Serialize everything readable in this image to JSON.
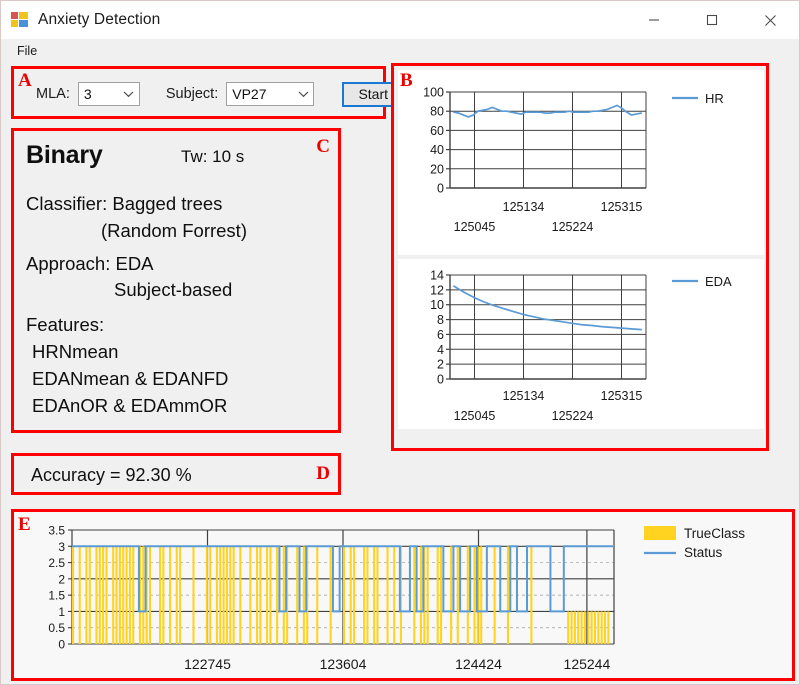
{
  "window": {
    "title": "Anxiety Detection",
    "icon": "app-icon",
    "minimize_label": "─",
    "maximize_label": "☐",
    "close_label": "✕"
  },
  "menu": {
    "items": [
      "File"
    ],
    "file_label": "File"
  },
  "annotations": {
    "a": "A",
    "b": "B",
    "c": "C",
    "d": "D",
    "e": "E",
    "color": "#ff0000"
  },
  "panelA": {
    "mla_label": "MLA:",
    "mla_value": "3",
    "subject_label": "Subject:",
    "subject_value": "VP27",
    "start_label": "Start"
  },
  "panelC": {
    "mode": "Binary",
    "tw": "Tw: 10 s",
    "classifier_line1": "Classifier: Bagged trees",
    "classifier_line2": "(Random Forrest)",
    "approach_line1": "Approach: EDA",
    "approach_line2": "Subject-based",
    "features_label": "Features:",
    "feature_1": "HRNmean",
    "feature_2": "EDANmean & EDANFD",
    "feature_3": "EDAnOR & EDAmmOR"
  },
  "panelD": {
    "accuracy_text": "Accuracy = 92.30 %"
  },
  "colors": {
    "series_blue": "#5b9bd5",
    "true_class_yellow": "#ffd320",
    "axis": "#404040",
    "accent_red": "#ff0000",
    "start_border_blue": "#1878d4"
  },
  "chart_data": [
    {
      "id": "hr-chart",
      "type": "line",
      "title": "",
      "xlabel": "",
      "ylabel": "",
      "ylim": [
        0,
        100
      ],
      "yticks": [
        0,
        20,
        40,
        60,
        80,
        100
      ],
      "xticks": [
        "125045",
        "125134",
        "125224",
        "125315"
      ],
      "xtick_positions": [
        0.125,
        0.375,
        0.625,
        0.875
      ],
      "grid": true,
      "legend": [
        {
          "name": "HR",
          "color": "#5b9bd5",
          "marker": "line"
        }
      ],
      "legend_position": "right",
      "series": [
        {
          "name": "HR",
          "color": "#5b9bd5",
          "x": [
            0,
            1,
            2,
            3,
            4,
            5,
            6,
            7,
            8,
            9,
            10,
            11,
            12,
            13,
            14,
            15,
            16,
            17,
            18,
            19,
            20,
            21,
            22,
            23,
            24,
            25,
            26,
            27,
            28,
            29,
            30,
            31,
            32,
            33,
            34,
            35,
            36,
            37,
            38,
            39
          ],
          "values": [
            79,
            78,
            76,
            74,
            76,
            80,
            81,
            82,
            84,
            82,
            80,
            80,
            79,
            78,
            77,
            79,
            79,
            79,
            79,
            78,
            78,
            79,
            79,
            79,
            80,
            79,
            79,
            79,
            79,
            80,
            80,
            81,
            82,
            84,
            86,
            83,
            79,
            76,
            77,
            78
          ]
        }
      ]
    },
    {
      "id": "eda-chart",
      "type": "line",
      "title": "",
      "xlabel": "",
      "ylabel": "",
      "ylim": [
        0,
        14
      ],
      "yticks": [
        0,
        2,
        4,
        6,
        8,
        10,
        12,
        14
      ],
      "xticks": [
        "125045",
        "125134",
        "125224",
        "125315"
      ],
      "xtick_positions": [
        0.125,
        0.375,
        0.625,
        0.875
      ],
      "grid": true,
      "legend": [
        {
          "name": "EDA",
          "color": "#5b9bd5",
          "marker": "line"
        }
      ],
      "legend_position": "right",
      "series": [
        {
          "name": "EDA",
          "color": "#5b9bd5",
          "x": [
            0,
            1,
            2,
            3,
            4,
            5,
            6,
            7,
            8,
            9,
            10,
            11,
            12,
            13,
            14,
            15,
            16,
            17,
            18,
            19
          ],
          "values": [
            12.5,
            11.7,
            11.0,
            10.4,
            9.9,
            9.5,
            9.1,
            8.7,
            8.4,
            8.1,
            7.9,
            7.7,
            7.5,
            7.3,
            7.2,
            7.05,
            6.95,
            6.85,
            6.75,
            6.65
          ]
        }
      ]
    },
    {
      "id": "classification-chart",
      "type": "bar",
      "title": "",
      "xlabel": "",
      "ylabel": "",
      "ylim": [
        0,
        3.5
      ],
      "yticks": [
        0,
        0.5,
        1,
        1.5,
        2,
        2.5,
        3,
        3.5
      ],
      "xticks": [
        "122745",
        "123604",
        "124424",
        "125244"
      ],
      "xtick_positions": [
        0.25,
        0.5,
        0.75,
        0.95
      ],
      "grid": true,
      "legend": [
        {
          "name": "TrueClass",
          "color": "#ffd320",
          "marker": "swatch"
        },
        {
          "name": "Status",
          "color": "#5b9bd5",
          "marker": "line"
        }
      ],
      "legend_position": "right",
      "series": [
        {
          "name": "TrueClass",
          "color": "#ffd320",
          "values": [
            3,
            0,
            3,
            0,
            3,
            3,
            0,
            3,
            3,
            3,
            3,
            0,
            3,
            3,
            3,
            3,
            3,
            3,
            3,
            0,
            3,
            3,
            3,
            3,
            0,
            0,
            3,
            3,
            0,
            3,
            0,
            3,
            3,
            0,
            0,
            0,
            3,
            0,
            0,
            0,
            3,
            3,
            0,
            3,
            3,
            3,
            3,
            3,
            3,
            0,
            3,
            0,
            0,
            3,
            0,
            3,
            3,
            0,
            3,
            3,
            0,
            3,
            0,
            3,
            3,
            0,
            0,
            3,
            0,
            3,
            3,
            0,
            0,
            3,
            0,
            0,
            0,
            3,
            0,
            0,
            0,
            3,
            0,
            3,
            3,
            0,
            0,
            3,
            3,
            0,
            3,
            3,
            0,
            0,
            3,
            0,
            3,
            0,
            3,
            0,
            0,
            0,
            3,
            0,
            3,
            3,
            3,
            0,
            0,
            3,
            3,
            0,
            0,
            3,
            0,
            3,
            0,
            0,
            3,
            0,
            3,
            3,
            3,
            0,
            0,
            0,
            3,
            0,
            0,
            0,
            3,
            0,
            0,
            0,
            0,
            0,
            0,
            3,
            0,
            0,
            0,
            0,
            0,
            0,
            0,
            0,
            0,
            0,
            1,
            1,
            1,
            1,
            1,
            1,
            1,
            1,
            1,
            1,
            1,
            1,
            1,
            0
          ]
        },
        {
          "name": "Status",
          "color": "#5b9bd5",
          "values": [
            3,
            3,
            3,
            3,
            3,
            3,
            3,
            3,
            3,
            3,
            3,
            3,
            3,
            3,
            3,
            3,
            3,
            3,
            3,
            3,
            1,
            1,
            3,
            3,
            3,
            3,
            3,
            3,
            3,
            3,
            3,
            3,
            3,
            3,
            3,
            3,
            3,
            3,
            3,
            3,
            3,
            3,
            3,
            3,
            3,
            3,
            3,
            3,
            3,
            3,
            3,
            3,
            3,
            3,
            3,
            3,
            3,
            3,
            3,
            3,
            3,
            3,
            1,
            1,
            3,
            3,
            3,
            3,
            1,
            1,
            3,
            3,
            3,
            3,
            3,
            3,
            3,
            3,
            1,
            1,
            3,
            3,
            3,
            3,
            3,
            3,
            3,
            3,
            3,
            3,
            3,
            3,
            3,
            3,
            3,
            3,
            3,
            3,
            1,
            1,
            1,
            3,
            3,
            1,
            1,
            3,
            3,
            3,
            3,
            3,
            3,
            1,
            1,
            1,
            3,
            3,
            1,
            1,
            1,
            3,
            3,
            1,
            1,
            1,
            3,
            3,
            3,
            3,
            1,
            1,
            1,
            3,
            3,
            1,
            1,
            1,
            3,
            3,
            3,
            3,
            3,
            3,
            3,
            1,
            1,
            1,
            1,
            3,
            3,
            3,
            3,
            3,
            3,
            3,
            3,
            3,
            3,
            3,
            3,
            3,
            3,
            3
          ]
        }
      ]
    }
  ]
}
